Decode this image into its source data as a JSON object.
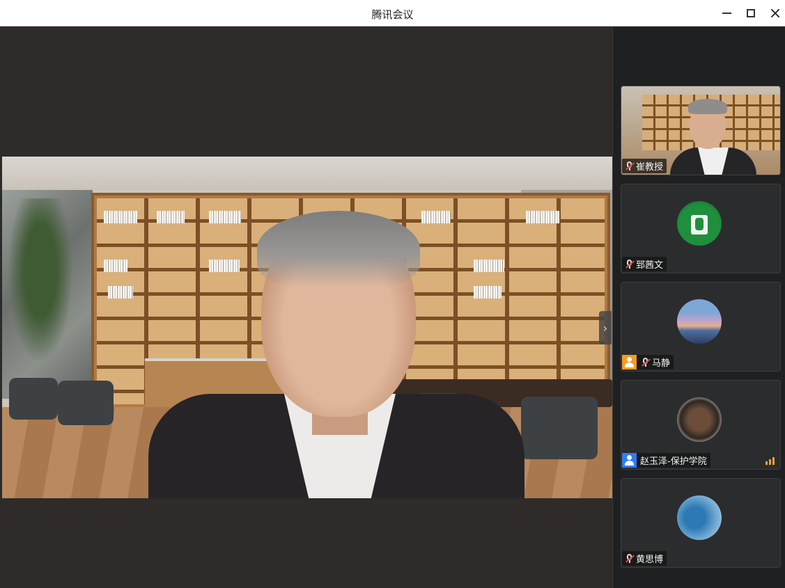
{
  "window": {
    "title": "腾讯会议",
    "controls": [
      "minimize-icon",
      "maximize-icon",
      "close-icon"
    ]
  },
  "main": {
    "next_panel_icon": "chevron-right-icon",
    "next_panel_glyph": "›"
  },
  "participants": [
    {
      "name": "崔教授",
      "mic": "muted",
      "type": "video"
    },
    {
      "name": "郅茜文",
      "mic": "muted",
      "type": "avatar",
      "avatar": "exit-sign-avatar"
    },
    {
      "name": "马静",
      "mic": "muted",
      "type": "avatar",
      "avatar": "sunset-avatar",
      "user_badge_color": "#f59b23"
    },
    {
      "name": "赵玉泽-保护学院",
      "mic": "on",
      "type": "avatar",
      "avatar": "pirate-avatar",
      "user_badge_color": "#2f7cf6",
      "signal": "good"
    },
    {
      "name": "黄思博",
      "mic": "muted",
      "type": "avatar",
      "avatar": "blue-avatar"
    }
  ],
  "colors": {
    "muted_mic": "#e5483e",
    "signal": "#f2a23a",
    "sidebar_bg": "#1f2021",
    "main_bg": "#2e2b29"
  }
}
